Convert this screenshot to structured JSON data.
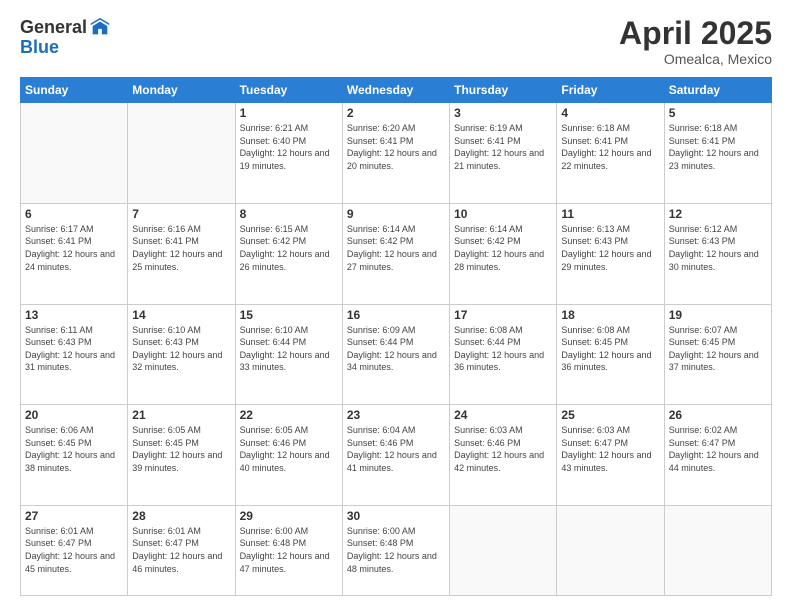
{
  "logo": {
    "general": "General",
    "blue": "Blue"
  },
  "header": {
    "month": "April 2025",
    "location": "Omealca, Mexico"
  },
  "days_of_week": [
    "Sunday",
    "Monday",
    "Tuesday",
    "Wednesday",
    "Thursday",
    "Friday",
    "Saturday"
  ],
  "weeks": [
    [
      {
        "day": "",
        "info": ""
      },
      {
        "day": "",
        "info": ""
      },
      {
        "day": "1",
        "info": "Sunrise: 6:21 AM\nSunset: 6:40 PM\nDaylight: 12 hours and 19 minutes."
      },
      {
        "day": "2",
        "info": "Sunrise: 6:20 AM\nSunset: 6:41 PM\nDaylight: 12 hours and 20 minutes."
      },
      {
        "day": "3",
        "info": "Sunrise: 6:19 AM\nSunset: 6:41 PM\nDaylight: 12 hours and 21 minutes."
      },
      {
        "day": "4",
        "info": "Sunrise: 6:18 AM\nSunset: 6:41 PM\nDaylight: 12 hours and 22 minutes."
      },
      {
        "day": "5",
        "info": "Sunrise: 6:18 AM\nSunset: 6:41 PM\nDaylight: 12 hours and 23 minutes."
      }
    ],
    [
      {
        "day": "6",
        "info": "Sunrise: 6:17 AM\nSunset: 6:41 PM\nDaylight: 12 hours and 24 minutes."
      },
      {
        "day": "7",
        "info": "Sunrise: 6:16 AM\nSunset: 6:41 PM\nDaylight: 12 hours and 25 minutes."
      },
      {
        "day": "8",
        "info": "Sunrise: 6:15 AM\nSunset: 6:42 PM\nDaylight: 12 hours and 26 minutes."
      },
      {
        "day": "9",
        "info": "Sunrise: 6:14 AM\nSunset: 6:42 PM\nDaylight: 12 hours and 27 minutes."
      },
      {
        "day": "10",
        "info": "Sunrise: 6:14 AM\nSunset: 6:42 PM\nDaylight: 12 hours and 28 minutes."
      },
      {
        "day": "11",
        "info": "Sunrise: 6:13 AM\nSunset: 6:43 PM\nDaylight: 12 hours and 29 minutes."
      },
      {
        "day": "12",
        "info": "Sunrise: 6:12 AM\nSunset: 6:43 PM\nDaylight: 12 hours and 30 minutes."
      }
    ],
    [
      {
        "day": "13",
        "info": "Sunrise: 6:11 AM\nSunset: 6:43 PM\nDaylight: 12 hours and 31 minutes."
      },
      {
        "day": "14",
        "info": "Sunrise: 6:10 AM\nSunset: 6:43 PM\nDaylight: 12 hours and 32 minutes."
      },
      {
        "day": "15",
        "info": "Sunrise: 6:10 AM\nSunset: 6:44 PM\nDaylight: 12 hours and 33 minutes."
      },
      {
        "day": "16",
        "info": "Sunrise: 6:09 AM\nSunset: 6:44 PM\nDaylight: 12 hours and 34 minutes."
      },
      {
        "day": "17",
        "info": "Sunrise: 6:08 AM\nSunset: 6:44 PM\nDaylight: 12 hours and 36 minutes."
      },
      {
        "day": "18",
        "info": "Sunrise: 6:08 AM\nSunset: 6:45 PM\nDaylight: 12 hours and 36 minutes."
      },
      {
        "day": "19",
        "info": "Sunrise: 6:07 AM\nSunset: 6:45 PM\nDaylight: 12 hours and 37 minutes."
      }
    ],
    [
      {
        "day": "20",
        "info": "Sunrise: 6:06 AM\nSunset: 6:45 PM\nDaylight: 12 hours and 38 minutes."
      },
      {
        "day": "21",
        "info": "Sunrise: 6:05 AM\nSunset: 6:45 PM\nDaylight: 12 hours and 39 minutes."
      },
      {
        "day": "22",
        "info": "Sunrise: 6:05 AM\nSunset: 6:46 PM\nDaylight: 12 hours and 40 minutes."
      },
      {
        "day": "23",
        "info": "Sunrise: 6:04 AM\nSunset: 6:46 PM\nDaylight: 12 hours and 41 minutes."
      },
      {
        "day": "24",
        "info": "Sunrise: 6:03 AM\nSunset: 6:46 PM\nDaylight: 12 hours and 42 minutes."
      },
      {
        "day": "25",
        "info": "Sunrise: 6:03 AM\nSunset: 6:47 PM\nDaylight: 12 hours and 43 minutes."
      },
      {
        "day": "26",
        "info": "Sunrise: 6:02 AM\nSunset: 6:47 PM\nDaylight: 12 hours and 44 minutes."
      }
    ],
    [
      {
        "day": "27",
        "info": "Sunrise: 6:01 AM\nSunset: 6:47 PM\nDaylight: 12 hours and 45 minutes."
      },
      {
        "day": "28",
        "info": "Sunrise: 6:01 AM\nSunset: 6:47 PM\nDaylight: 12 hours and 46 minutes."
      },
      {
        "day": "29",
        "info": "Sunrise: 6:00 AM\nSunset: 6:48 PM\nDaylight: 12 hours and 47 minutes."
      },
      {
        "day": "30",
        "info": "Sunrise: 6:00 AM\nSunset: 6:48 PM\nDaylight: 12 hours and 48 minutes."
      },
      {
        "day": "",
        "info": ""
      },
      {
        "day": "",
        "info": ""
      },
      {
        "day": "",
        "info": ""
      }
    ]
  ]
}
